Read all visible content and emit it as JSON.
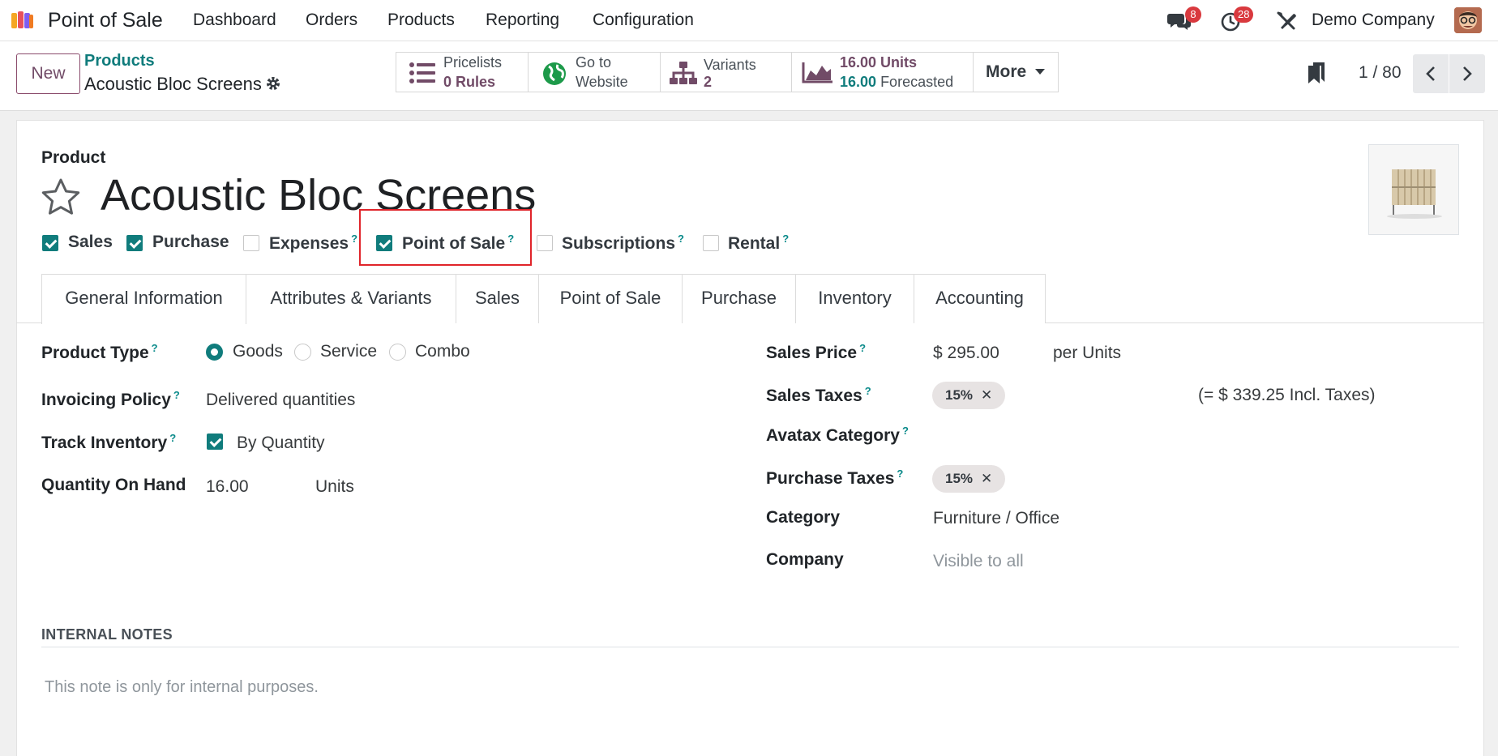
{
  "navbar": {
    "app_name": "Point of Sale",
    "menu": [
      "Dashboard",
      "Orders",
      "Products",
      "Reporting",
      "Configuration"
    ],
    "messages_count": "8",
    "activities_count": "28",
    "company": "Demo Company"
  },
  "control_panel": {
    "new_label": "New",
    "breadcrumb_parent": "Products",
    "breadcrumb_current": "Acoustic Bloc Screens",
    "pager": "1 / 80",
    "smart_buttons": {
      "pricelists": {
        "title": "Pricelists",
        "value": "0 Rules"
      },
      "website": {
        "line1": "Go to",
        "line2": "Website"
      },
      "variants": {
        "title": "Variants",
        "value": "2"
      },
      "units": {
        "line1": "16.00 Units",
        "line2_value": "16.00",
        "line2_label": "Forecasted"
      },
      "more": "More"
    }
  },
  "form": {
    "kind_label": "Product",
    "title": "Acoustic Bloc Screens",
    "options": [
      {
        "label": "Sales",
        "checked": true,
        "help": ""
      },
      {
        "label": "Purchase",
        "checked": true,
        "help": ""
      },
      {
        "label": "Expenses",
        "checked": false,
        "help": "?"
      },
      {
        "label": "Point of Sale",
        "checked": true,
        "help": "?"
      },
      {
        "label": "Subscriptions",
        "checked": false,
        "help": "?"
      },
      {
        "label": "Rental",
        "checked": false,
        "help": "?"
      }
    ],
    "tabs": [
      "General Information",
      "Attributes & Variants",
      "Sales",
      "Point of Sale",
      "Purchase",
      "Inventory",
      "Accounting"
    ],
    "left": {
      "product_type": {
        "label": "Product Type",
        "help": "?",
        "options": [
          "Goods",
          "Service",
          "Combo"
        ],
        "selected": "Goods"
      },
      "invoicing_policy": {
        "label": "Invoicing Policy",
        "help": "?",
        "value": "Delivered quantities"
      },
      "track_inventory": {
        "label": "Track Inventory",
        "help": "?",
        "value": "By Quantity"
      },
      "qty_on_hand": {
        "label": "Quantity On Hand",
        "value": "16.00",
        "unit": "Units"
      }
    },
    "right": {
      "sales_price": {
        "label": "Sales Price",
        "help": "?",
        "value": "$ 295.00",
        "unit": "per Units"
      },
      "sales_taxes": {
        "label": "Sales Taxes",
        "help": "?",
        "tag": "15%",
        "incl": "(= $ 339.25 Incl. Taxes)"
      },
      "avatax_category": {
        "label": "Avatax Category",
        "help": "?"
      },
      "purchase_taxes": {
        "label": "Purchase Taxes",
        "help": "?",
        "tag": "15%"
      },
      "category": {
        "label": "Category",
        "value": "Furniture / Office"
      },
      "company": {
        "label": "Company",
        "placeholder": "Visible to all"
      }
    },
    "internal_notes": {
      "heading": "INTERNAL NOTES",
      "placeholder": "This note is only for internal purposes."
    }
  },
  "colors": {
    "brand": "#714b67",
    "accent": "#107c7c",
    "highlight": "#e0242a"
  }
}
